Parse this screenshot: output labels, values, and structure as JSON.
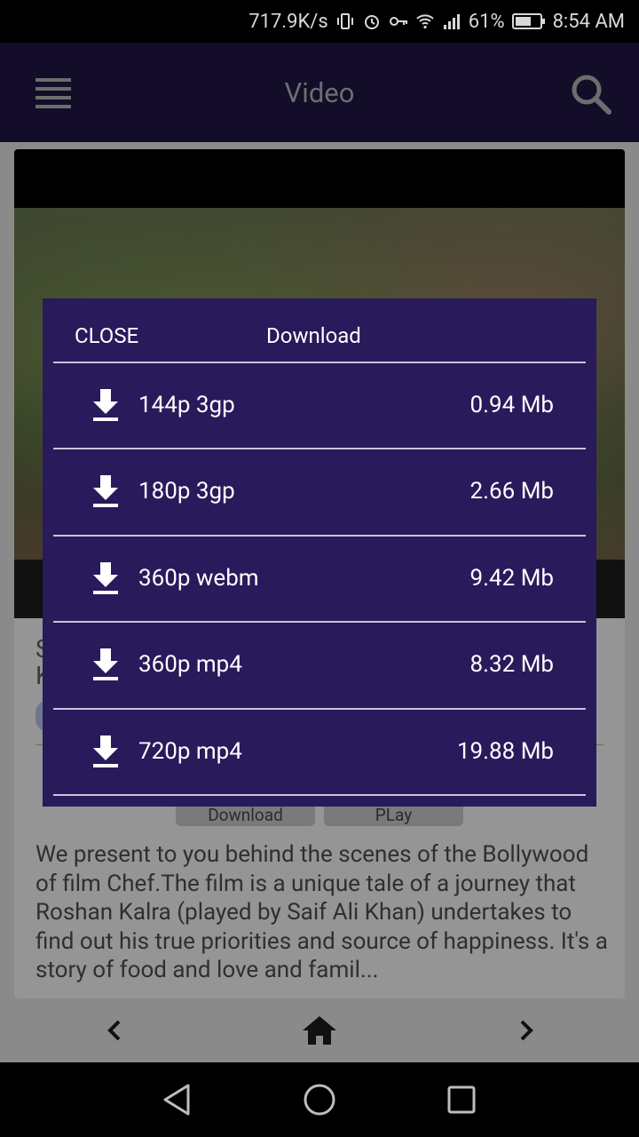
{
  "status_bar": {
    "speed": "717.9K/s",
    "battery": "61%",
    "time": "8:54 AM"
  },
  "app_bar": {
    "title": "Video"
  },
  "video_card": {
    "title_fragment_1": "S",
    "title_fragment_2": "K",
    "download_pill": "Download",
    "play_pill": "PLay",
    "description": "We present to you behind the scenes of the Bollywood of film Chef.The film is a unique tale of a journey that Roshan Kalra (played by Saif Ali Khan) undertakes to find out his true priorities and source of happiness. It's a story of food and love and famil..."
  },
  "dialog": {
    "close_label": "CLOSE",
    "title": "Download",
    "options": [
      {
        "quality": "144p 3gp",
        "size": "0.94 Mb"
      },
      {
        "quality": "180p 3gp",
        "size": "2.66 Mb"
      },
      {
        "quality": "360p webm",
        "size": "9.42 Mb"
      },
      {
        "quality": "360p mp4",
        "size": "8.32 Mb"
      },
      {
        "quality": "720p mp4",
        "size": "19.88 Mb"
      }
    ]
  },
  "colors": {
    "dialog_bg": "#281a5b",
    "app_bar_bg": "#130d2a"
  },
  "icons": {
    "menu": "menu-icon",
    "search": "search-icon",
    "download": "download-icon",
    "back": "chevron-left-icon",
    "home": "home-icon",
    "forward": "chevron-right-icon"
  }
}
